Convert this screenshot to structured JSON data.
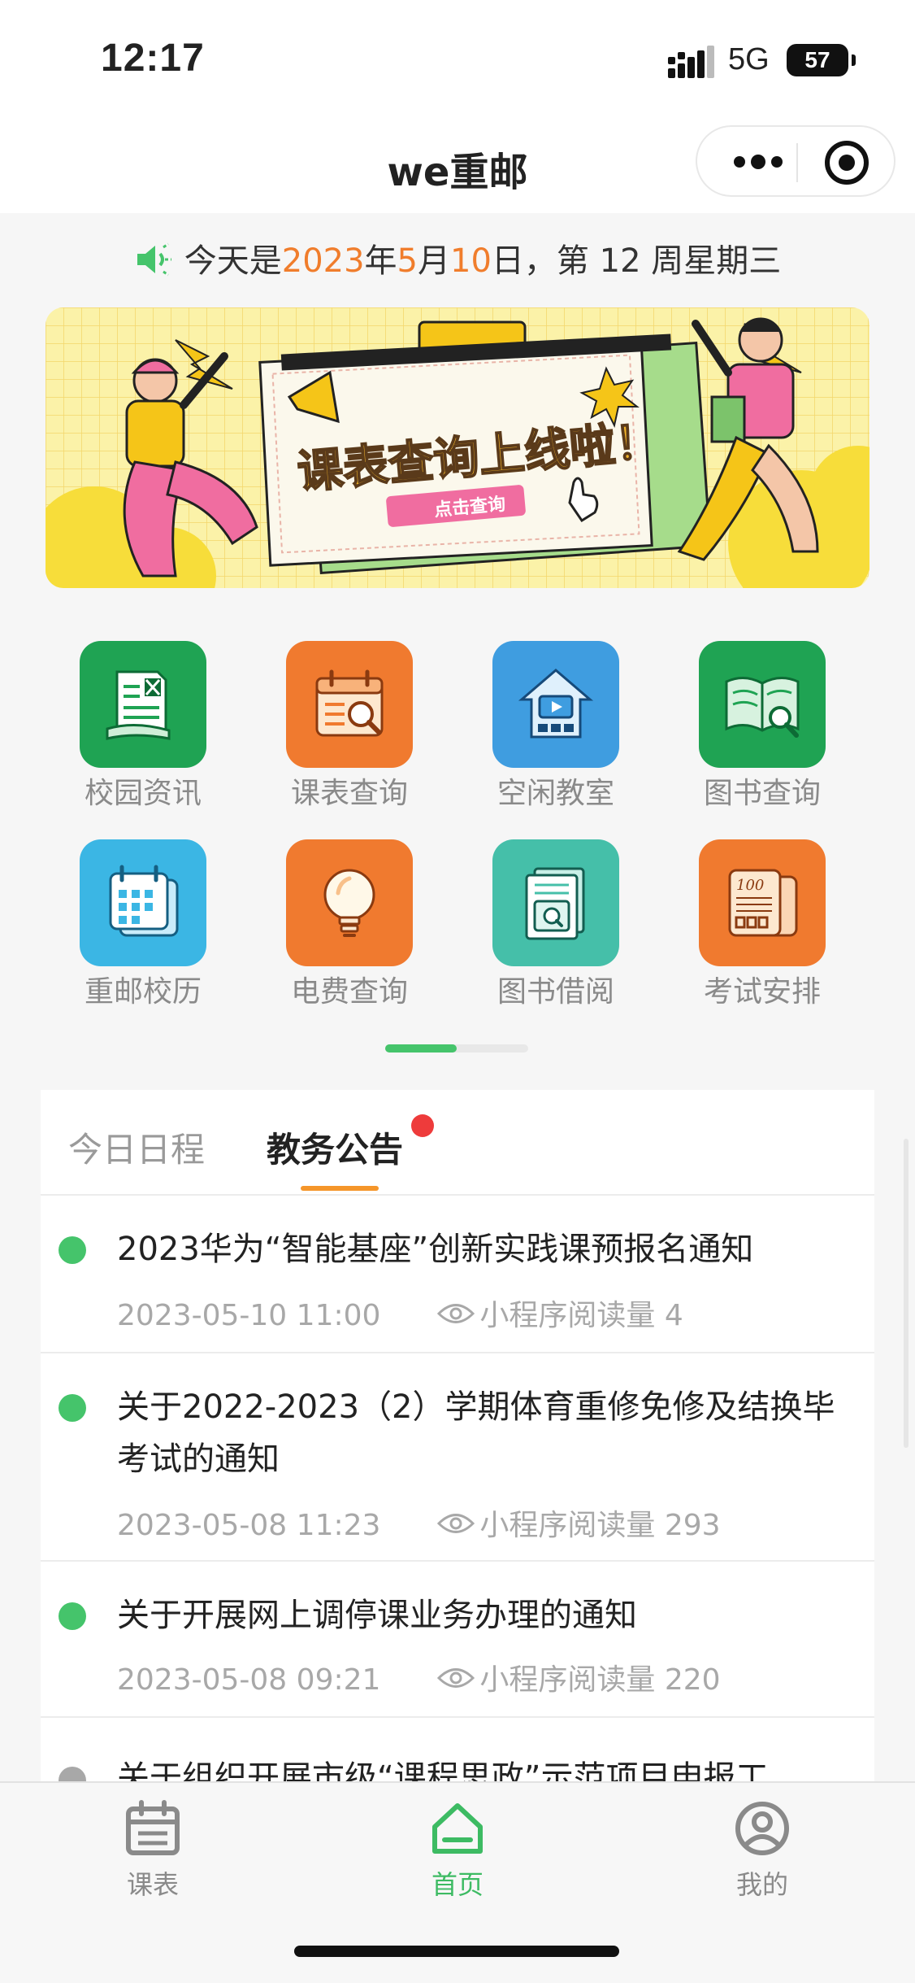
{
  "status_bar": {
    "time": "12:17",
    "network": "5G",
    "battery": "57"
  },
  "nav": {
    "title": "we重邮"
  },
  "date_line": {
    "prefix": "今天是",
    "year": "2023",
    "year_unit": "年",
    "month": "5",
    "month_unit": "月",
    "day": "10",
    "day_unit": "日，",
    "week": "第 12 周星期三"
  },
  "banner": {
    "headline": "课表查询上线啦！",
    "button": "点击查询"
  },
  "grid": {
    "items": [
      {
        "label": "校园资讯",
        "color": "#1fa353",
        "icon": "newspaper-icon"
      },
      {
        "label": "课表查询",
        "color": "#f07a2f",
        "icon": "calendar-search-icon"
      },
      {
        "label": "空闲教室",
        "color": "#3f9de0",
        "icon": "classroom-icon"
      },
      {
        "label": "图书查询",
        "color": "#1fa353",
        "icon": "book-search-icon"
      },
      {
        "label": "重邮校历",
        "color": "#3bb6e4",
        "icon": "calendar-icon"
      },
      {
        "label": "电费查询",
        "color": "#f07a2f",
        "icon": "lightbulb-icon"
      },
      {
        "label": "图书借阅",
        "color": "#45bfa9",
        "icon": "book-borrow-icon"
      },
      {
        "label": "考试安排",
        "color": "#f07a2f",
        "icon": "exam-calculator-icon"
      }
    ],
    "page_index": 1,
    "page_count": 2
  },
  "tabs": {
    "schedule": "今日日程",
    "notices": "教务公告"
  },
  "notices": [
    {
      "title": "2023华为“智能基座”创新实践课预报名通知",
      "date": "2023-05-10 11:00",
      "views": "小程序阅读量 4"
    },
    {
      "title": "关于2022-2023（2）学期体育重修免修及结换毕考试的通知",
      "date": "2023-05-08 11:23",
      "views": "小程序阅读量 293"
    },
    {
      "title": "关于开展网上调停课业务办理的通知",
      "date": "2023-05-08 09:21",
      "views": "小程序阅读量 220"
    },
    {
      "title": "关于组织开展市级“课程思政”示范项目申报工"
    }
  ],
  "tabbar": {
    "schedule": "课表",
    "home": "首页",
    "mine": "我的"
  },
  "colors": {
    "accent_green": "#3dbb63",
    "accent_orange": "#f07d2c",
    "badge_red": "#ee3b3b"
  }
}
